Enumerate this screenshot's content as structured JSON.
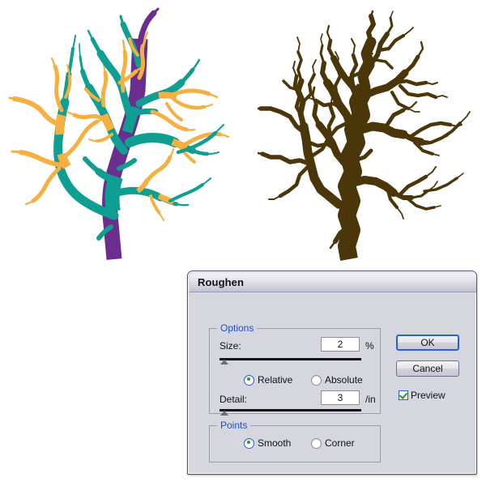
{
  "artwork": {
    "original_tree": {
      "name": "tree-original",
      "description": "Original vector tree drawing with multicolored stroke segments",
      "colors": {
        "trunk_purple": "#6B2D8E",
        "branch_teal": "#0E9E92",
        "twig_orange": "#F5B041"
      }
    },
    "roughened_tree": {
      "name": "tree-roughened",
      "description": "Same tree after Roughen effect applied, filled solid brown",
      "colors": {
        "fill_brown": "#4A3608"
      }
    }
  },
  "dialog": {
    "title": "Roughen",
    "colors": {
      "dialog_background": "#D6D6DE",
      "group_label_blue": "#1B4FD8",
      "default_button_border": "#2A5FD8",
      "check_green": "#1F9B1F"
    },
    "options": {
      "legend": "Options",
      "size": {
        "label": "Size:",
        "value": "2",
        "unit": "%",
        "slider_percent": 4
      },
      "mode": {
        "relative": {
          "label": "Relative",
          "selected": true
        },
        "absolute": {
          "label": "Absolute",
          "selected": false
        }
      },
      "detail": {
        "label": "Detail:",
        "value": "3",
        "unit": "/in",
        "slider_percent": 4
      }
    },
    "points": {
      "legend": "Points",
      "smooth": {
        "label": "Smooth",
        "selected": true
      },
      "corner": {
        "label": "Corner",
        "selected": false
      }
    },
    "actions": {
      "ok": "OK",
      "cancel": "Cancel",
      "preview": {
        "label": "Preview",
        "checked": true
      }
    }
  }
}
